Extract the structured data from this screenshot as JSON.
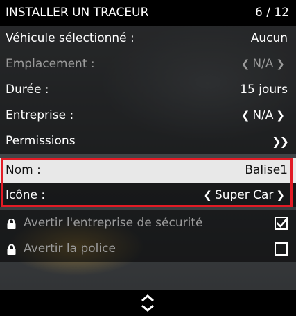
{
  "header": {
    "title": "INSTALLER UN TRACEUR",
    "page": "6 / 12"
  },
  "rows": [
    {
      "label": "Véhicule sélectionné :",
      "value": "Aucun"
    },
    {
      "label": "Emplacement :",
      "value": "N/A"
    },
    {
      "label": "Durée :",
      "value": "15 jours"
    },
    {
      "label": "Entreprise :",
      "value": "N/A"
    },
    {
      "label": "Permissions",
      "value": ""
    },
    {
      "label": "Nom :",
      "value": "Balise1"
    },
    {
      "label": "Icône :",
      "value": "Super Car"
    }
  ],
  "checks": [
    {
      "label": "Avertir l'entreprise de sécurité",
      "checked": true,
      "locked": true
    },
    {
      "label": "Avertir la police",
      "checked": false,
      "locked": true
    }
  ],
  "icons": {
    "left": "chevron-left-icon",
    "right": "chevron-right-icon",
    "submenu": "double-chevron-right-icon",
    "lock": "lock-icon",
    "check": "checkmark-icon",
    "scroll": "up-down-arrows-icon"
  },
  "colors": {
    "highlight": "#e21b25",
    "selected_row": "#e8e8e8",
    "header": "#000000"
  }
}
